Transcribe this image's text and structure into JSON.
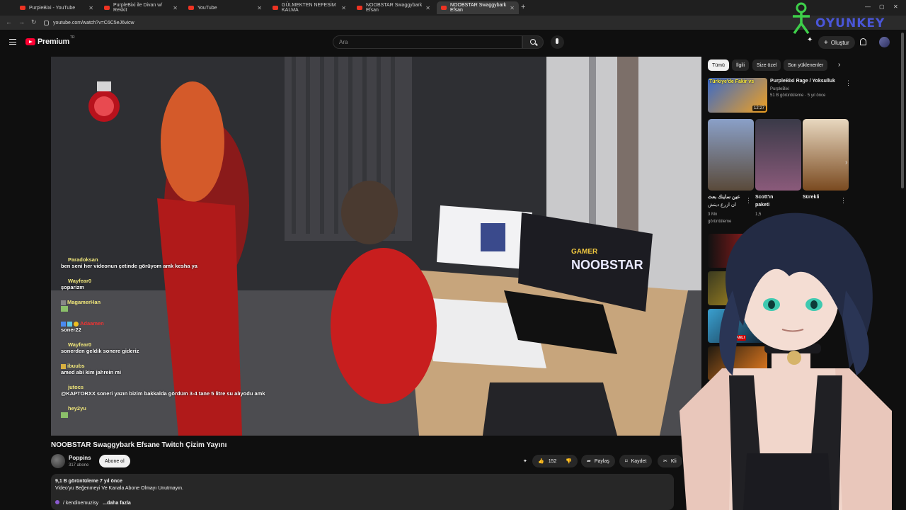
{
  "browser": {
    "tabs": [
      {
        "label": "PurpleBixi - YouTube"
      },
      {
        "label": "PurpleBixi ile Divan w/ Rekkit"
      },
      {
        "label": "YouTube"
      },
      {
        "label": "GÜLMEKTEN NEFESİM KALMA"
      },
      {
        "label": "NOOBSTAR Swaggybark Efsan"
      },
      {
        "label": "NOOBSTAR Swaggybark Efsan"
      }
    ],
    "url": "youtube.com/watch?v=C6C5eJ6vicw"
  },
  "header": {
    "logo_text": "Premium",
    "logo_sup": "TR",
    "search_placeholder": "Ara",
    "create_label": "Oluştur"
  },
  "overlay_brand": "OYUNKEY",
  "chat": [
    {
      "user": "Paradoksan",
      "text": "ben seni her videonun çetinde görüyom amk kesha ya"
    },
    {
      "user": "Wayfear0",
      "text": "şoparizm"
    },
    {
      "user": "MagamerHan",
      "text": ""
    },
    {
      "user": "Adaamen",
      "text": "soner22"
    },
    {
      "user": "Wayfear0",
      "text": "sonerden geldik sonere gideriz"
    },
    {
      "user": "ibuubs",
      "text": "amed abi kim jahrein mi"
    },
    {
      "user": "jutocs",
      "text": "@KAPTORXX soneri yazın bizim bakkalda gördüm 3-4 tane 5 litre su alıyodu amk"
    },
    {
      "user": "hey2yu",
      "text": ""
    }
  ],
  "video": {
    "title": "NOOBSTAR Swaggybark Efsane Twitch Çizim Yayını",
    "channel": "Poppins",
    "subscribers": "317 abone",
    "subscribe_label": "Abone ol",
    "likes": "152",
    "share_label": "Paylaş",
    "save_label": "Kaydet",
    "clip_label": "Kli",
    "stats": "9,1 B görüntüleme  7 yıl önce",
    "description": "Video'yu Beğenmeyi Ve Kanala Abone Olmayı Unutmayın.",
    "desc_tag": "/ kendinemuzisy",
    "more_label": "...daha fazla",
    "screen_text": "NOOBSTAR",
    "screen_sub": "GAMER"
  },
  "chips": [
    "Tümü",
    "İlgili",
    "Size özel",
    "Son yüklenenler"
  ],
  "recommendations": [
    {
      "thumb_text": "Türkiye'de Fakir vs",
      "title": "PurpleBixi Rage / Yoksulluk",
      "channel": "PurpleBixi",
      "meta": "51 B görüntüleme · 5 yıl önce",
      "duration": "12:27"
    }
  ],
  "shorts": [
    {
      "title": "عين ساينك بعث",
      "sub1": "ان ازرع دينش",
      "sub2": "3 Mn",
      "sub3": "görüntüleme"
    },
    {
      "title": "Scott'ın",
      "sub1": "paketi",
      "sub2": "1,5",
      "sub3": ""
    },
    {
      "title": "Sürekli",
      "sub1": "",
      "sub2": "",
      "sub3": ""
    }
  ],
  "badge_live": "CANLI",
  "colors": {
    "accent": "#ff0033",
    "chat_user": "#f0e67a",
    "brand": "#4a56d8"
  }
}
